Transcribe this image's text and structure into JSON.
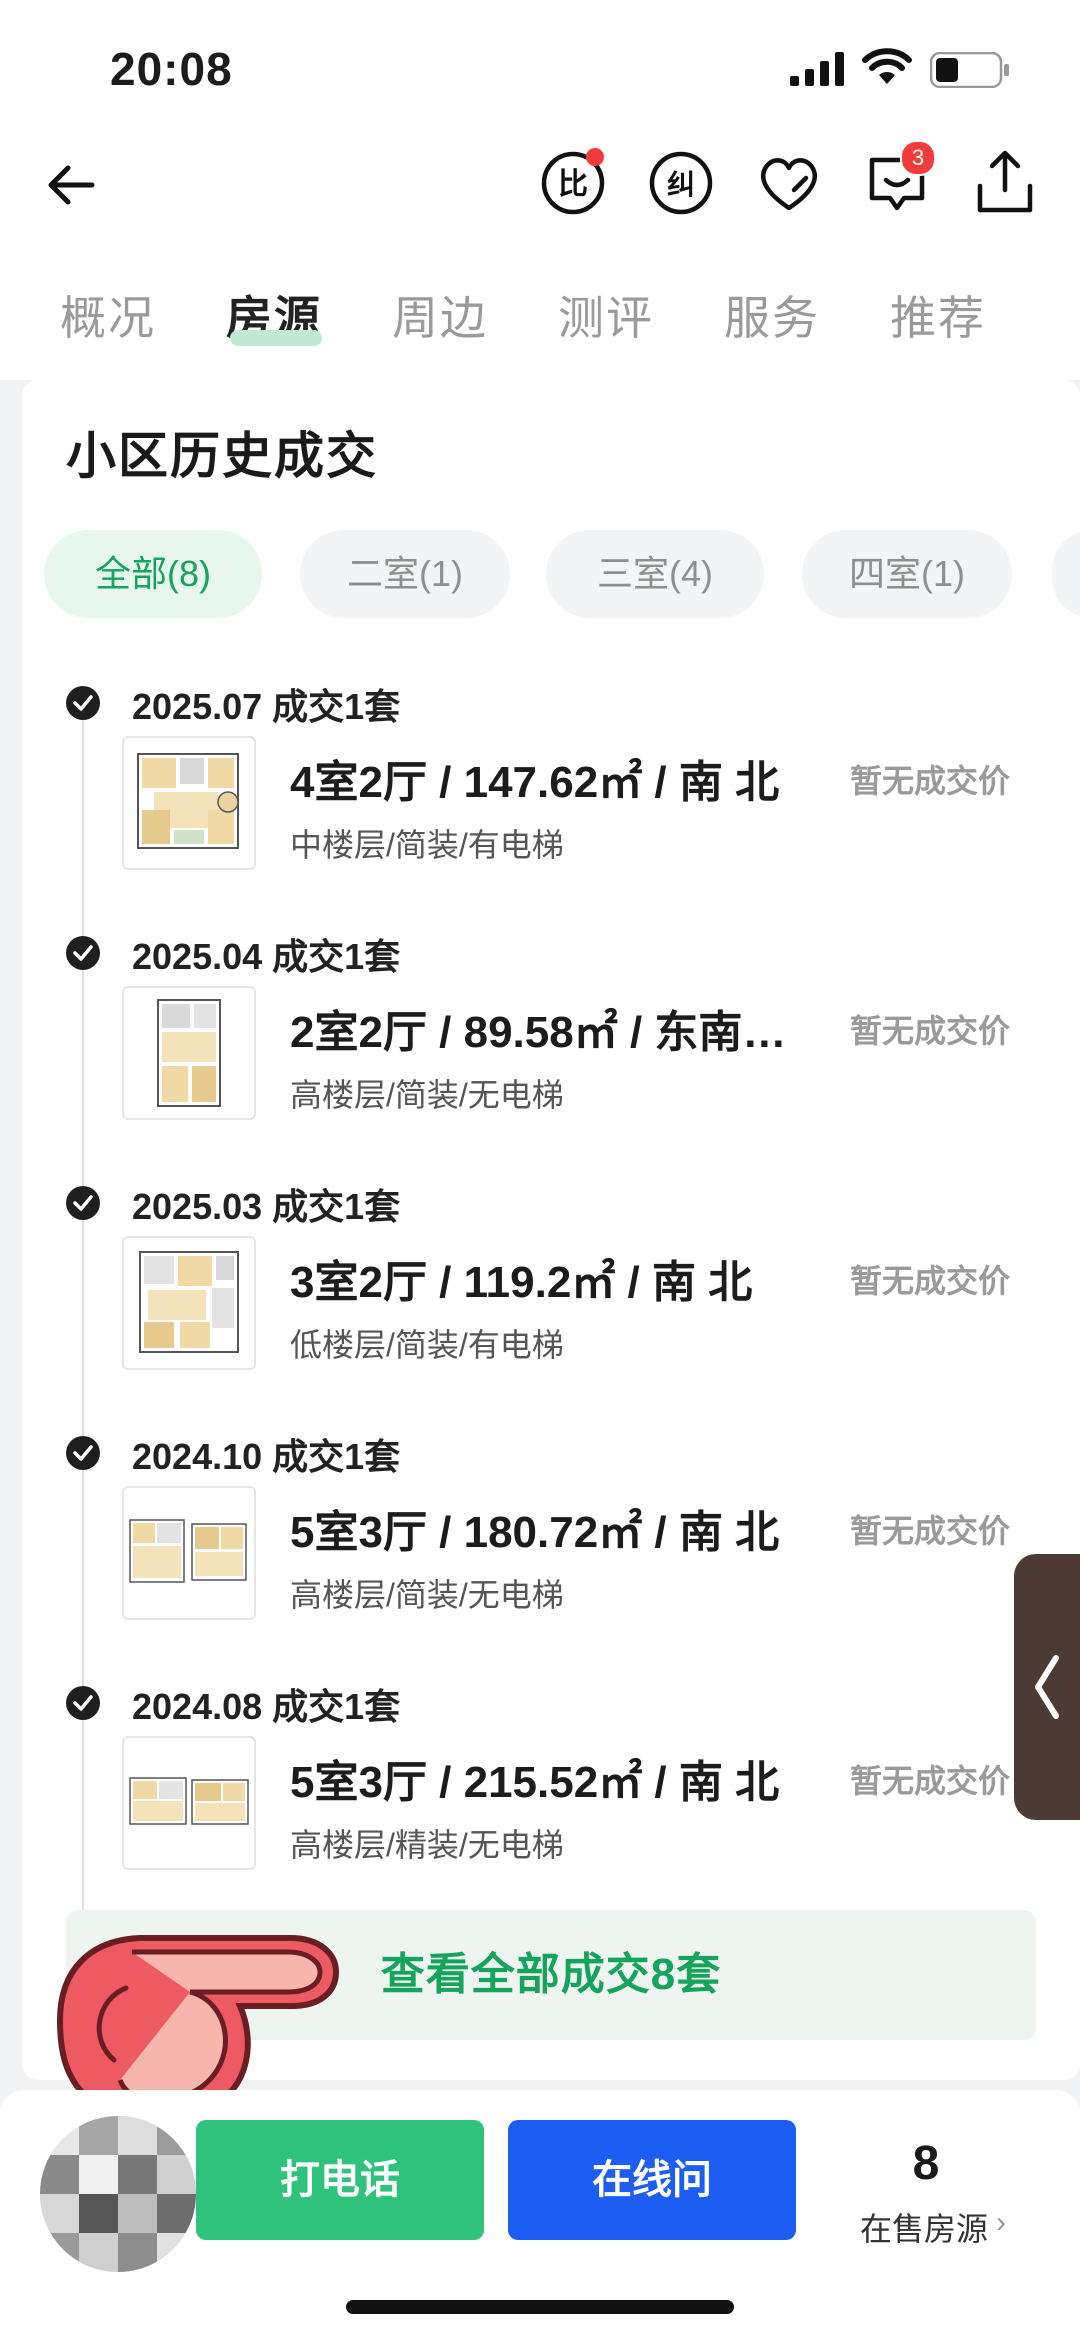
{
  "status_bar": {
    "time": "20:08"
  },
  "nav": {
    "message_badge": "3"
  },
  "tabs": [
    {
      "label": "概况",
      "active": false
    },
    {
      "label": "房源",
      "active": true
    },
    {
      "label": "周边",
      "active": false
    },
    {
      "label": "测评",
      "active": false
    },
    {
      "label": "服务",
      "active": false
    },
    {
      "label": "推荐",
      "active": false
    }
  ],
  "section": {
    "title": "小区历史成交",
    "filters": [
      {
        "label": "全部(8)",
        "active": true
      },
      {
        "label": "二室(1)",
        "active": false
      },
      {
        "label": "三室(4)",
        "active": false
      },
      {
        "label": "四室(1)",
        "active": false
      }
    ],
    "records": [
      {
        "date": "2025.07 成交1套",
        "main": "4室2厅 / 147.62㎡ / 南 北",
        "sub": "中楼层/简装/有电梯",
        "price": "暂无成交价"
      },
      {
        "date": "2025.04 成交1套",
        "main": "2室2厅 / 89.58㎡ / 东南…",
        "sub": "高楼层/简装/无电梯",
        "price": "暂无成交价"
      },
      {
        "date": "2025.03 成交1套",
        "main": "3室2厅 / 119.2㎡ / 南 北",
        "sub": "低楼层/简装/有电梯",
        "price": "暂无成交价"
      },
      {
        "date": "2024.10 成交1套",
        "main": "5室3厅 / 180.72㎡ / 南 北",
        "sub": "高楼层/简装/无电梯",
        "price": "暂无成交价"
      },
      {
        "date": "2024.08 成交1套",
        "main": "5室3厅 / 215.52㎡ / 南 北",
        "sub": "高楼层/精装/无电梯",
        "price": "暂无成交价"
      }
    ],
    "view_all": "查看全部成交8套"
  },
  "bottom_bar": {
    "call_label": "打电话",
    "chat_label": "在线问",
    "sale_count": "8",
    "sale_label": "在售房源"
  },
  "colors": {
    "accent_green": "#16a35b",
    "call_green": "#2fc27a",
    "chat_blue": "#1e5df1",
    "badge_red": "#f23c3c"
  }
}
